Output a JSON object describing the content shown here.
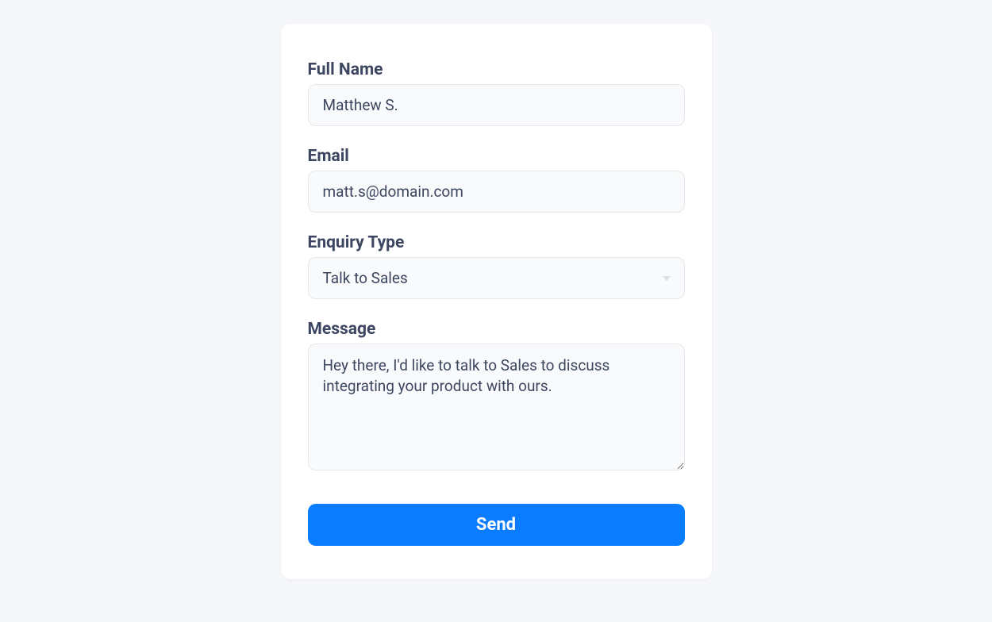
{
  "form": {
    "fullName": {
      "label": "Full Name",
      "value": "Matthew S."
    },
    "email": {
      "label": "Email",
      "value": "matt.s@domain.com"
    },
    "enquiryType": {
      "label": "Enquiry Type",
      "selected": "Talk to Sales"
    },
    "message": {
      "label": "Message",
      "value": "Hey there, I'd like to talk to Sales to discuss integrating your product with ours."
    },
    "submitLabel": "Send"
  }
}
